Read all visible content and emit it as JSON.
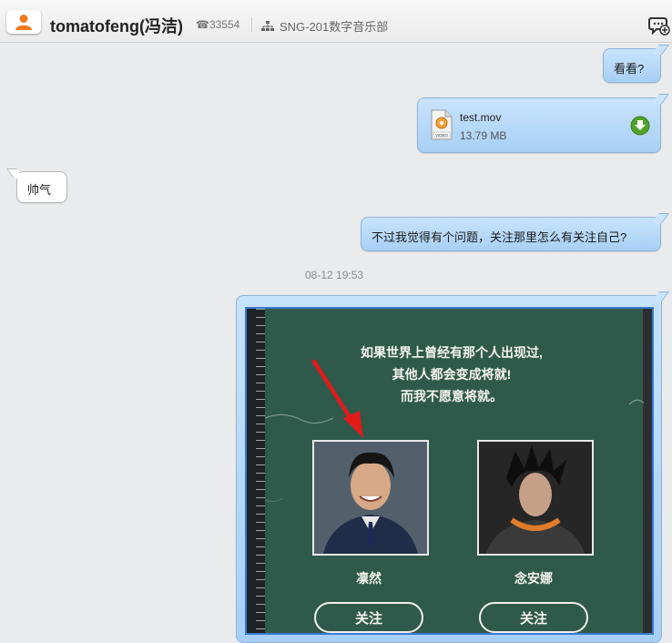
{
  "header": {
    "contact_name": "tomatofeng(冯洁)",
    "phone": "☎33554",
    "department": "SNG-201数字音乐部"
  },
  "messages": {
    "msg1": "看看?",
    "file": {
      "name": "test.mov",
      "size": "13.79 MB",
      "type_label": "VIDEO"
    },
    "msg2": "帅气",
    "msg3": "不过我觉得有个问题，关注那里怎么有关注自己?",
    "timestamp": "08-12 19:53"
  },
  "image_message": {
    "poem_lines": [
      "如果世界上曾经有那个人出现过,",
      "其他人都会变成将就!",
      "而我不愿意将就。"
    ],
    "people": [
      {
        "name": "凛然",
        "follow_label": "关注"
      },
      {
        "name": "念安娜",
        "follow_label": "关注"
      }
    ]
  },
  "colors": {
    "outgoing_bubble": "#b9dbf8",
    "board_green": "#2f5a4b",
    "arrow_red": "#e11a1a",
    "download_green": "#52a128"
  }
}
